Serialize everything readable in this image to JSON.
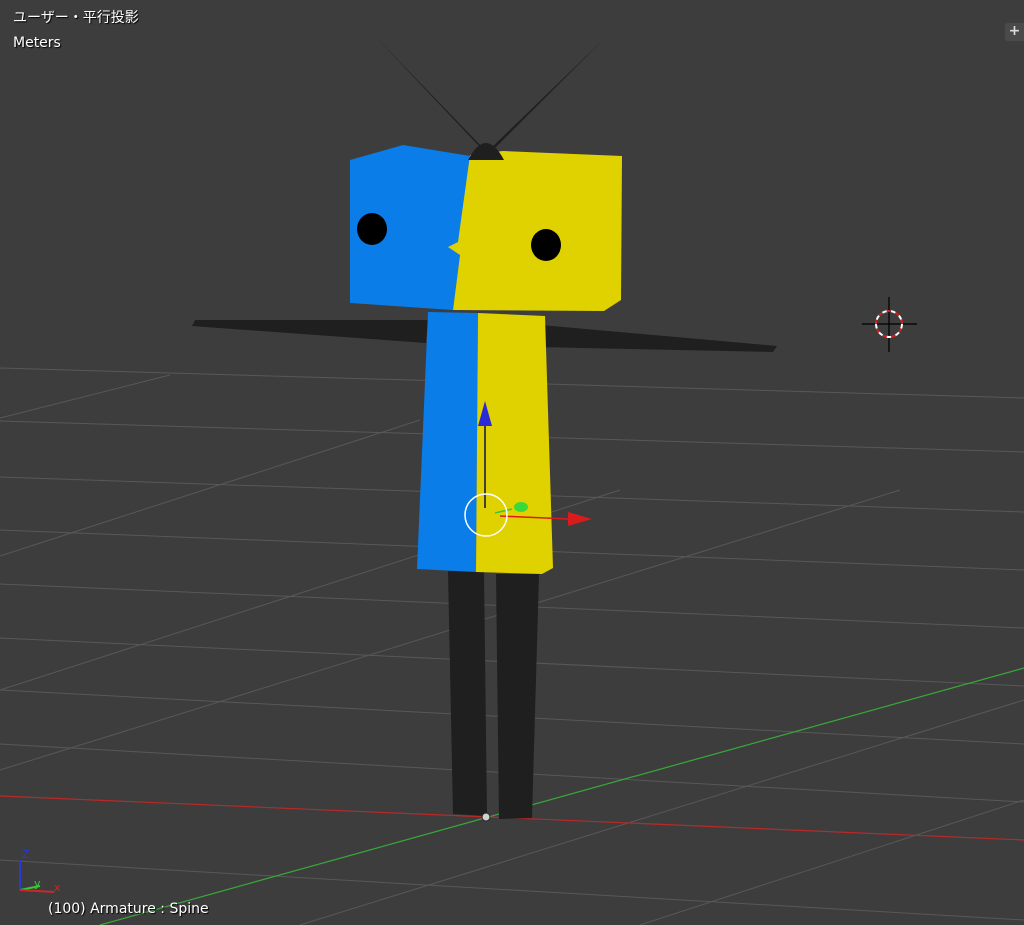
{
  "viewport": {
    "view_title": "ユーザー・平行投影",
    "unit_label": "Meters",
    "status_line": "(100) Armature : Spine",
    "corner_widget": "+",
    "axis_labels": {
      "z": "Z",
      "y": "y",
      "x": "x"
    }
  },
  "colors": {
    "background": "#3d3d3d",
    "grid": "#585858",
    "x_axis": "#b82a2a",
    "y_axis": "#3aa83a",
    "z_axis": "#2a3ad0",
    "mesh_blue": "#0a7de8",
    "mesh_yellow": "#e0d200",
    "dark_part": "#1f1f1f"
  },
  "icons": [
    "3d-cursor-icon",
    "transform-gizmo-icon",
    "axis-gizmo-icon",
    "plus-icon"
  ]
}
